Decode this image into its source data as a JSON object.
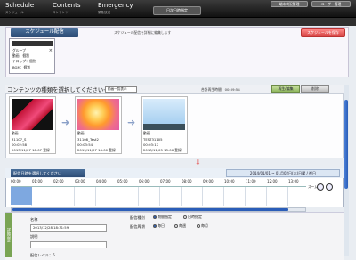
{
  "nav": {
    "tabs": [
      {
        "label": "Schedule",
        "sub": "スケジュール"
      },
      {
        "label": "Contents",
        "sub": "コンテンツ"
      },
      {
        "label": "Emergency",
        "sub": "緊急放送"
      }
    ],
    "button": "日次日時指定"
  },
  "subbar": {
    "btn1": "端末状況管理",
    "btn2": "ユーザー管理"
  },
  "schedule": {
    "heading": "スケジュール配信",
    "hint": "スケジュール配信を詳細に編集します",
    "save": "スケジュールを保存",
    "card": {
      "close": "×",
      "line1": "グループ",
      "line2": "動画：個別",
      "line3": "テロップ：個別",
      "line4": "BGM：個別"
    }
  },
  "contents": {
    "label": "コンテンツの種類を選択してください→",
    "select": "動画一覧表示",
    "total": "合計再生時間：00:09:58",
    "tab_edit": "再生/編集",
    "tab_delete": "削除",
    "items": [
      {
        "type": "動画",
        "name": "31107_S",
        "duration": "00:02:58",
        "date": "2013/11/07 18:07 登録"
      },
      {
        "type": "動画",
        "name": "31108_Test2",
        "duration": "00:03:54",
        "date": "2013/11/07 14:00 登録"
      },
      {
        "type": "動画",
        "name": "TEST31105",
        "duration": "00:03:17",
        "date": "2013/11/05 13:06 登録"
      }
    ]
  },
  "timeline": {
    "title": "配信日時を選択してください",
    "date": "2014/01/01 ~ 01月02日(木)日曜 / 祝日",
    "hours": [
      "00:00",
      "01:00",
      "02:00",
      "03:00",
      "04:00",
      "05:00",
      "06:00",
      "07:00",
      "08:00",
      "09:00",
      "10:00",
      "11:00",
      "12:00",
      "13:00",
      "14:0"
    ],
    "zoom": "ズーム"
  },
  "detail": {
    "tab": "詳細設定",
    "name_label": "名称",
    "name_value": "2013/12/28 18:31:59",
    "desc_label": "説明",
    "level_label": "配信レベル：5",
    "kind_label": "配信種別",
    "kind_opt1": "期間指定",
    "kind_opt2": "日時指定",
    "period_label": "配信周期",
    "period_opt1": "毎日",
    "period_opt2": "毎週",
    "period_opt3": "毎月"
  }
}
